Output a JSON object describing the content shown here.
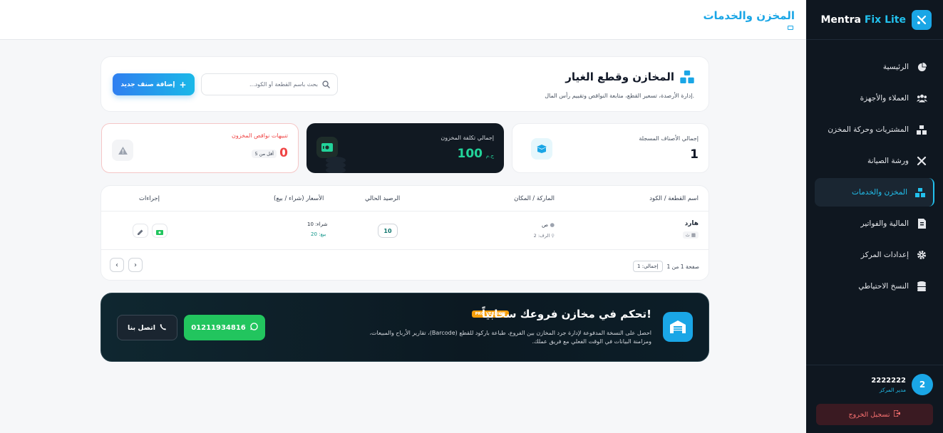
{
  "brand": {
    "name_main": "Mentra",
    "name_accent": "Fix Lite"
  },
  "sidebar": {
    "items": [
      {
        "label": "الرئيسية",
        "icon": "pie-chart-icon"
      },
      {
        "label": "العملاء والأجهزة",
        "icon": "users-icon"
      },
      {
        "label": "المشتريات وحركة المخزن",
        "icon": "boxes-icon"
      },
      {
        "label": "ورشة الصيانة",
        "icon": "tools-icon"
      },
      {
        "label": "المخزن والخدمات",
        "icon": "boxes-icon",
        "active": true
      },
      {
        "label": "المالية والفواتير",
        "icon": "invoice-icon"
      },
      {
        "label": "إعدادات المركز",
        "icon": "gear-icon"
      },
      {
        "label": "النسخ الاحتياطي",
        "icon": "database-icon"
      }
    ]
  },
  "user": {
    "avatar": "2",
    "name": "2222222",
    "role": "مدير المركز"
  },
  "logout_label": "تسجيل الخروج",
  "topbar": {
    "title": "المخزن والخدمات"
  },
  "header": {
    "title": "المخازن وقطع الغيار",
    "subtitle": "إدارة الأرصدة، تسعير القطع، متابعة النواقص وتقييم رأس المال.",
    "search_placeholder": "بحث باسم القطعة أو الكود...",
    "add_label": "إضافة صنف جديد"
  },
  "stats": {
    "total_items": {
      "label": "إجمالي الأصناف المسجلة",
      "value": "1"
    },
    "total_cost": {
      "label": "إجمالي تكلفة المخزون",
      "value": "100",
      "unit": "ج.م"
    },
    "shortage": {
      "label": "تنبيهات نواقص المخزون",
      "value": "0",
      "badge": "أقل من 5"
    }
  },
  "table": {
    "headers": {
      "name": "اسم القطعة / الكود",
      "brand": "الماركة / المكان",
      "stock": "الرصيد الحالي",
      "prices": "الأسعار (شراء / بيع)",
      "actions": "إجراءات"
    },
    "rows": [
      {
        "name": "هارد",
        "code": "ث",
        "brand": "ص",
        "shelf": "الرف: 2",
        "stock": "10",
        "buy": "شراء: 10",
        "sell": "بيع: 20"
      }
    ],
    "footer": {
      "page_text": "صفحة 1 من 1",
      "total": "إجمالي: 1"
    }
  },
  "promo": {
    "badge": "PRO VERSION",
    "title": "تحكم في مخازن فروعك سحابياً!",
    "description": "احصل على النسخة المدفوعة لإدارة جرد المخازن بين الفروع، طباعة باركود للقطع (Barcode)، تقارير الأرباح والمبيعات، ومزامنة البيانات في الوقت الفعلي مع فريق عملك.",
    "whatsapp": "01211934816",
    "call_label": "اتصل بنا"
  },
  "colors": {
    "accent": "#1aa6e6",
    "sidebar_bg": "#0f1720",
    "success": "#22c55e",
    "danger": "#ef4444"
  }
}
